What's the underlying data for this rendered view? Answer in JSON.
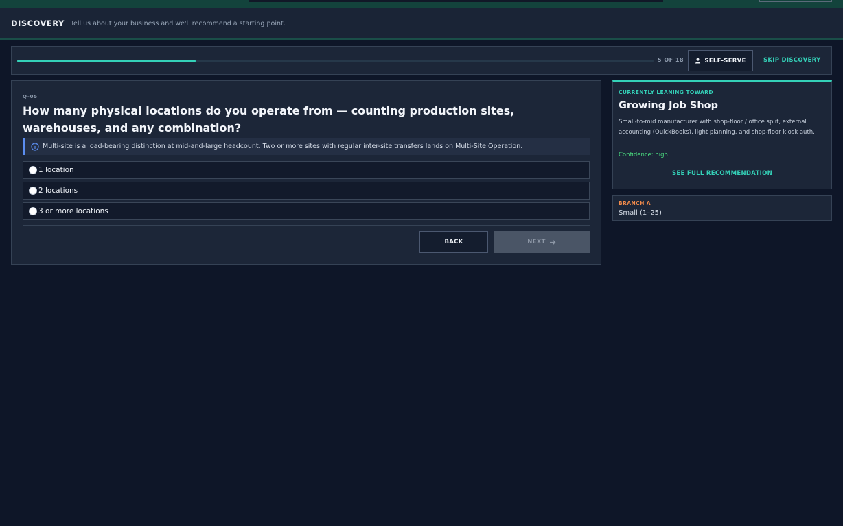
{
  "header": {
    "title": "DISCOVERY",
    "subtitle": "Tell us about your business and we'll recommend a starting point."
  },
  "progress": {
    "current": 5,
    "total": 18,
    "label": "5 OF 18",
    "fraction": 0.28
  },
  "toolbar": {
    "self_serve_label": "SELF-SERVE",
    "skip_label": "SKIP DISCOVERY"
  },
  "question": {
    "id": "Q-05",
    "text": "How many physical locations do you operate from — counting production sites, warehouses, and any combination?",
    "info": "Multi-site is a load-bearing distinction at mid-and-large headcount. Two or more sites with regular inter-site transfers lands on Multi-Site Operation.",
    "options": [
      "1 location",
      "2 locations",
      "3 or more locations"
    ],
    "selected": null
  },
  "nav": {
    "back_label": "BACK",
    "next_label": "NEXT"
  },
  "leaning": {
    "label": "CURRENTLY LEANING TOWARD",
    "title": "Growing Job Shop",
    "description": "Small-to-mid manufacturer with shop-floor / office split, external accounting (QuickBooks), light planning, and shop-floor kiosk auth.",
    "confidence": "Confidence: high",
    "link_label": "SEE FULL RECOMMENDATION"
  },
  "branch": {
    "label": "BRANCH A",
    "value": "Small (1–25)"
  },
  "colors": {
    "accent": "#34d1b8",
    "background": "#0e1628",
    "panel": "#1c2638",
    "info_border": "#5b8def",
    "confidence": "#4ade80",
    "branch": "#f08a4b"
  },
  "icons": {
    "self_serve": "person-icon",
    "info": "info-icon",
    "next": "arrow-right-icon"
  }
}
